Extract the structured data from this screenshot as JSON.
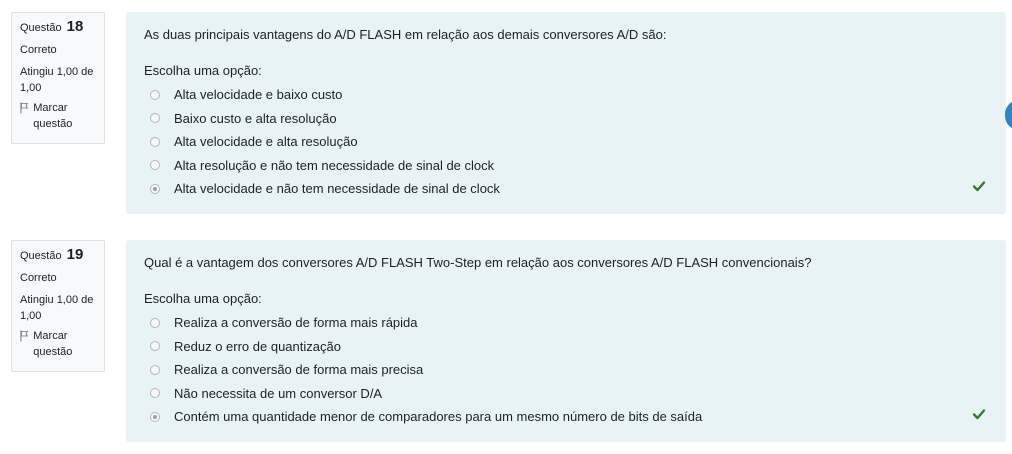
{
  "questions": [
    {
      "label": "Questão",
      "number": "18",
      "state": "Correto",
      "grade": "Atingiu 1,00 de 1,00",
      "flag_label": "Marcar questão",
      "text": "As duas principais vantagens do A/D FLASH em relação aos demais conversores A/D são:",
      "prompt": "Escolha uma opção:",
      "options": [
        "Alta velocidade e baixo custo",
        "Baixo custo e alta resolução",
        "Alta velocidade e alta resolução",
        "Alta resolução e não tem necessidade de sinal de clock",
        "Alta velocidade e não tem necessidade de sinal de clock"
      ],
      "selected_index": 4
    },
    {
      "label": "Questão",
      "number": "19",
      "state": "Correto",
      "grade": "Atingiu 1,00 de 1,00",
      "flag_label": "Marcar questão",
      "text": "Qual é a vantagem dos conversores A/D FLASH Two-Step em relação aos conversores A/D FLASH convencionais?",
      "prompt": "Escolha uma opção:",
      "options": [
        "Realiza a conversão de forma mais rápida",
        "Reduz o erro de quantização",
        "Realiza a conversão de forma mais precisa",
        "Não necessita de um conversor D/A",
        "Contém uma quantidade menor de comparadores para um mesmo número de bits de saída"
      ],
      "selected_index": 4
    }
  ],
  "colors": {
    "content_bg": "#e7f3f5",
    "info_bg": "#f8f9fa",
    "correct": "#357a32",
    "accent": "#0f6cbf"
  },
  "icons": [
    "flag-icon",
    "check-icon"
  ]
}
